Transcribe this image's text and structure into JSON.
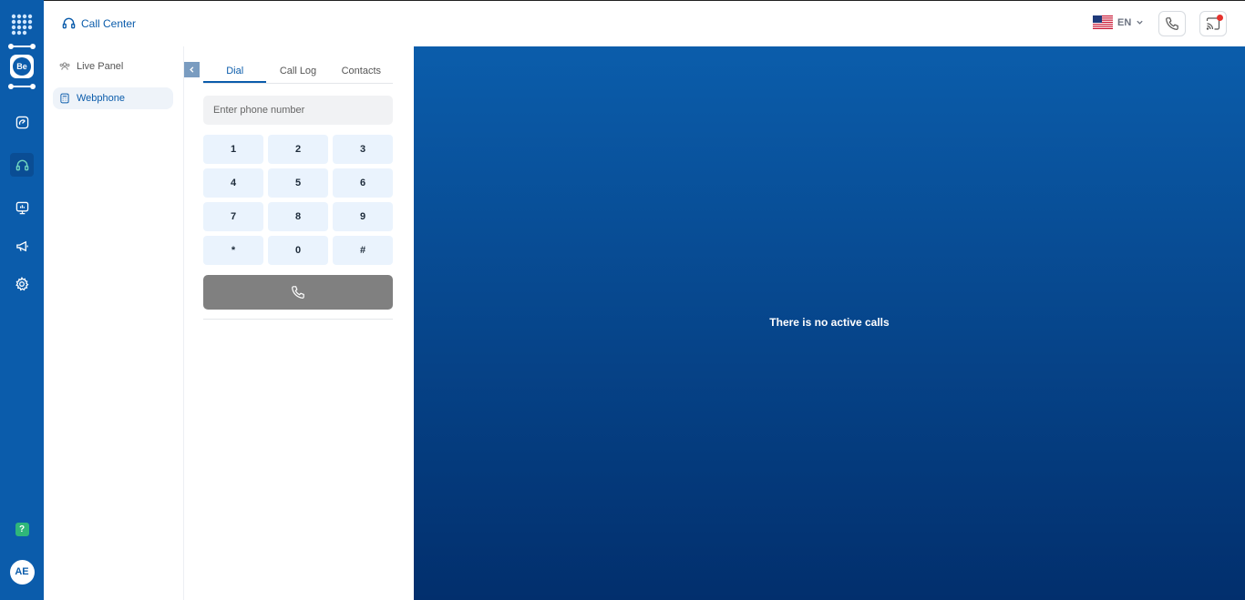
{
  "rail": {
    "brand": "Be",
    "user_initials": "AE",
    "help_symbol": "?",
    "icons": [
      "apps-grid-icon",
      "dashboard-icon",
      "headset-icon",
      "monitor-icon",
      "megaphone-icon",
      "settings-icon",
      "help-icon"
    ]
  },
  "header": {
    "title": "Call Center",
    "language": "EN"
  },
  "submenu": {
    "items": [
      {
        "label": "Live Panel",
        "active": false
      },
      {
        "label": "Webphone",
        "active": true
      }
    ]
  },
  "dialer": {
    "tabs": [
      {
        "label": "Dial",
        "active": true
      },
      {
        "label": "Call Log",
        "active": false
      },
      {
        "label": "Contacts",
        "active": false
      }
    ],
    "input_placeholder": "Enter phone number",
    "keys": [
      "1",
      "2",
      "3",
      "4",
      "5",
      "6",
      "7",
      "8",
      "9",
      "*",
      "0",
      "#"
    ]
  },
  "main": {
    "empty_message": "There is no active calls"
  },
  "colors": {
    "primary": "#0b5cab",
    "main_gradient_top": "#0b5dab",
    "main_gradient_bottom": "#022f6d",
    "call_button": "#808080",
    "key_background": "#eaf3fd",
    "notification_dot": "#e5322d",
    "help_badge": "#2fb67a"
  }
}
